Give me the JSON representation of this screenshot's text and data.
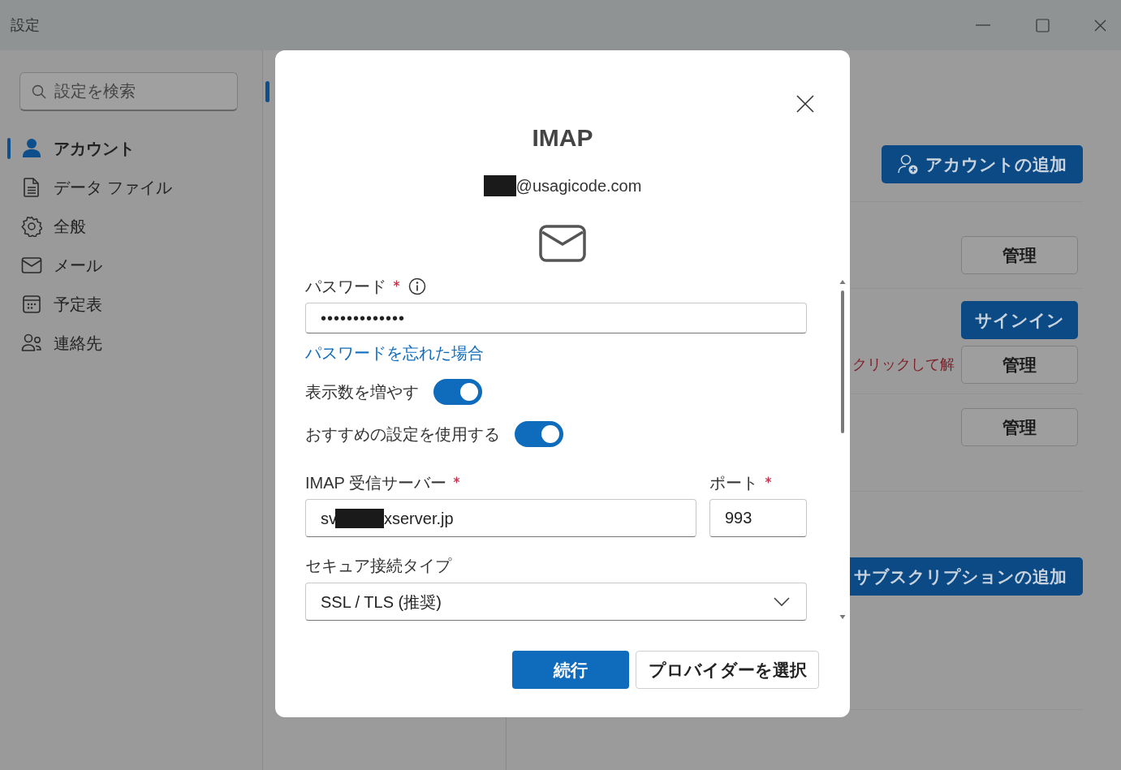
{
  "window": {
    "title": "設定",
    "controls": [
      {
        "kind": "minimize"
      },
      {
        "kind": "maximize"
      },
      {
        "kind": "close"
      }
    ]
  },
  "sidebar": {
    "search": {
      "placeholder": "設定を検索"
    },
    "items": [
      {
        "label": "アカウント",
        "kind": "person",
        "selected": true
      },
      {
        "label": "データ ファイル",
        "kind": "document",
        "selected": false
      },
      {
        "label": "全般",
        "kind": "gear",
        "selected": false
      },
      {
        "label": "メール",
        "kind": "mail",
        "selected": false
      },
      {
        "label": "予定表",
        "kind": "calendar",
        "selected": false
      },
      {
        "label": "連絡先",
        "kind": "people",
        "selected": false
      }
    ]
  },
  "accounts_panel": {
    "add_account_button": "アカウントの追加",
    "rows": [
      {
        "buttons": [
          {
            "label": "管理",
            "kind": "outline"
          }
        ]
      },
      {
        "note": "クリックして解",
        "buttons": [
          {
            "label": "サインイン",
            "kind": "primary"
          },
          {
            "label": "管理",
            "kind": "outline"
          }
        ]
      },
      {
        "buttons": [
          {
            "label": "管理",
            "kind": "outline"
          }
        ]
      }
    ],
    "add_subscription_button": "サブスクリプションの追加"
  },
  "dialog": {
    "title": "IMAP",
    "email": {
      "redacted_prefix": true,
      "text": "@usagicode.com"
    },
    "password": {
      "label": "パスワード",
      "required": true,
      "info": true,
      "value": "•••••••••••••"
    },
    "forgot_link": "パスワードを忘れた場合",
    "toggles": [
      {
        "label": "表示数を増やす",
        "on": true
      },
      {
        "label": "おすすめの設定を使用する",
        "on": true
      }
    ],
    "server": {
      "label": "IMAP 受信サーバー",
      "required": true,
      "value_start": "sv",
      "redacted": true,
      "value_end": "xserver.jp"
    },
    "port": {
      "label": "ポート",
      "required": true,
      "value": "993"
    },
    "security": {
      "label": "セキュア接続タイプ",
      "value": "SSL / TLS (推奨)"
    },
    "buttons": [
      {
        "label": "続行",
        "kind": "primary"
      },
      {
        "label": "プロバイダーを選択",
        "kind": "secondary"
      }
    ]
  }
}
